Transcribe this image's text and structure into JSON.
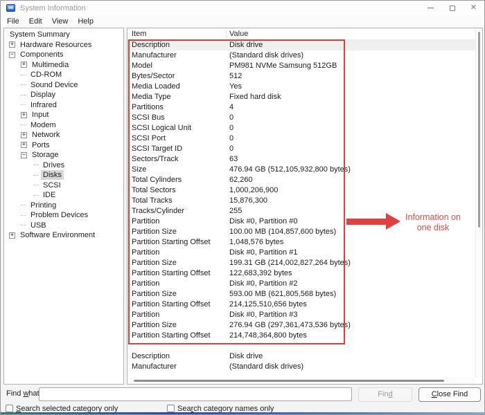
{
  "window": {
    "title": "System Information",
    "accent_red": "#e13b3c",
    "close_glyph": "✕"
  },
  "menu": {
    "items": [
      "File",
      "Edit",
      "View",
      "Help"
    ]
  },
  "tree": {
    "items": [
      {
        "label": "System Summary",
        "level": 0,
        "expander": "none",
        "selected": false
      },
      {
        "label": "Hardware Resources",
        "level": 1,
        "expander": "plus",
        "selected": false
      },
      {
        "label": "Components",
        "level": 1,
        "expander": "minus",
        "selected": false
      },
      {
        "label": "Multimedia",
        "level": 2,
        "expander": "plus",
        "selected": false
      },
      {
        "label": "CD-ROM",
        "level": 2,
        "expander": "none",
        "selected": false
      },
      {
        "label": "Sound Device",
        "level": 2,
        "expander": "none",
        "selected": false
      },
      {
        "label": "Display",
        "level": 2,
        "expander": "none",
        "selected": false
      },
      {
        "label": "Infrared",
        "level": 2,
        "expander": "none",
        "selected": false
      },
      {
        "label": "Input",
        "level": 2,
        "expander": "plus",
        "selected": false
      },
      {
        "label": "Modem",
        "level": 2,
        "expander": "none",
        "selected": false
      },
      {
        "label": "Network",
        "level": 2,
        "expander": "plus",
        "selected": false
      },
      {
        "label": "Ports",
        "level": 2,
        "expander": "plus",
        "selected": false
      },
      {
        "label": "Storage",
        "level": 2,
        "expander": "minus",
        "selected": false
      },
      {
        "label": "Drives",
        "level": 3,
        "expander": "none",
        "selected": false
      },
      {
        "label": "Disks",
        "level": 3,
        "expander": "none",
        "selected": true
      },
      {
        "label": "SCSI",
        "level": 3,
        "expander": "none",
        "selected": false
      },
      {
        "label": "IDE",
        "level": 3,
        "expander": "none",
        "selected": false
      },
      {
        "label": "Printing",
        "level": 2,
        "expander": "none",
        "selected": false
      },
      {
        "label": "Problem Devices",
        "level": 2,
        "expander": "none",
        "selected": false
      },
      {
        "label": "USB",
        "level": 2,
        "expander": "none",
        "selected": false
      },
      {
        "label": "Software Environment",
        "level": 1,
        "expander": "plus",
        "selected": false
      }
    ]
  },
  "table": {
    "columns": [
      "Item",
      "Value"
    ],
    "rows": [
      [
        "Description",
        "Disk drive"
      ],
      [
        "Manufacturer",
        "(Standard disk drives)"
      ],
      [
        "Model",
        "PM981 NVMe Samsung 512GB"
      ],
      [
        "Bytes/Sector",
        "512"
      ],
      [
        "Media Loaded",
        "Yes"
      ],
      [
        "Media Type",
        "Fixed hard disk"
      ],
      [
        "Partitions",
        "4"
      ],
      [
        "SCSI Bus",
        "0"
      ],
      [
        "SCSI Logical Unit",
        "0"
      ],
      [
        "SCSI Port",
        "0"
      ],
      [
        "SCSI Target ID",
        "0"
      ],
      [
        "Sectors/Track",
        "63"
      ],
      [
        "Size",
        "476.94 GB (512,105,932,800 bytes)"
      ],
      [
        "Total Cylinders",
        "62,260"
      ],
      [
        "Total Sectors",
        "1,000,206,900"
      ],
      [
        "Total Tracks",
        "15,876,300"
      ],
      [
        "Tracks/Cylinder",
        "255"
      ],
      [
        "Partition",
        "Disk #0, Partition #0"
      ],
      [
        "Partition Size",
        "100.00 MB (104,857,600 bytes)"
      ],
      [
        "Partition Starting Offset",
        "1,048,576 bytes"
      ],
      [
        "Partition",
        "Disk #0, Partition #1"
      ],
      [
        "Partition Size",
        "199.31 GB (214,002,827,264 bytes)"
      ],
      [
        "Partition Starting Offset",
        "122,683,392 bytes"
      ],
      [
        "Partition",
        "Disk #0, Partition #2"
      ],
      [
        "Partition Size",
        "593.00 MB (621,805,568 bytes)"
      ],
      [
        "Partition Starting Offset",
        "214,125,510,656 bytes"
      ],
      [
        "Partition",
        "Disk #0, Partition #3"
      ],
      [
        "Partition Size",
        "276.94 GB (297,361,473,536 bytes)"
      ],
      [
        "Partition Starting Offset",
        "214,748,364,800 bytes"
      ]
    ],
    "overflow_rows": [
      [
        "Description",
        "Disk drive"
      ],
      [
        "Manufacturer",
        "(Standard disk drives)"
      ]
    ]
  },
  "annotation": {
    "lines": [
      "Information on",
      "one disk"
    ]
  },
  "find_bar": {
    "label": {
      "pre": "Find ",
      "key": "w",
      "post": "hat:"
    },
    "input_value": "",
    "find_button": {
      "pre": "Fin",
      "key": "d",
      "post": "",
      "enabled": false
    },
    "close_button": {
      "pre": "",
      "key": "C",
      "post": "lose Find",
      "enabled": true
    }
  },
  "checkboxes": [
    {
      "pre": "",
      "key": "S",
      "post": "earch selected category only",
      "checked": false
    },
    {
      "pre": "Sea",
      "key": "r",
      "post": "ch category names only",
      "checked": false
    }
  ]
}
